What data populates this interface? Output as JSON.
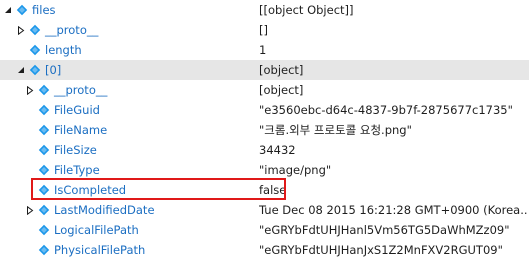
{
  "rows": [
    {
      "name": "files",
      "value": "[[object Object]]",
      "expander": "expanded",
      "icon": "property-icon"
    },
    {
      "name": "__proto__",
      "value": "[]",
      "expander": "collapsed",
      "icon": "property-icon"
    },
    {
      "name": "length",
      "value": "1",
      "expander": "none",
      "icon": "property-icon"
    },
    {
      "name": "[0]",
      "value": "[object]",
      "expander": "expanded",
      "icon": "property-icon"
    },
    {
      "name": "__proto__",
      "value": "[object]",
      "expander": "collapsed",
      "icon": "property-icon"
    },
    {
      "name": "FileGuid",
      "value": "\"e3560ebc-d64c-4837-9b7f-2875677c1735\"",
      "expander": "none",
      "icon": "property-icon"
    },
    {
      "name": "FileName",
      "value": "\"크롬.외부 프로토콜 요청.png\"",
      "expander": "none",
      "icon": "property-icon"
    },
    {
      "name": "FileSize",
      "value": "34432",
      "expander": "none",
      "icon": "property-icon"
    },
    {
      "name": "FileType",
      "value": "\"image/png\"",
      "expander": "none",
      "icon": "property-icon"
    },
    {
      "name": "IsCompleted",
      "value": "false",
      "expander": "none",
      "icon": "property-icon"
    },
    {
      "name": "LastModifiedDate",
      "value": "Tue Dec 08 2015 16:21:28 GMT+0900 (Korea...",
      "expander": "collapsed",
      "icon": "property-icon"
    },
    {
      "name": "LogicalFilePath",
      "value": "\"eGRYbFdtUHJHanl5Vm56TG5DaWhMZz09\"",
      "expander": "none",
      "icon": "property-icon"
    },
    {
      "name": "PhysicalFilePath",
      "value": "\"eGRYbFdtUHJHanJxS1Z2MnFXV2RGUT09\"",
      "expander": "none",
      "icon": "property-icon"
    }
  ],
  "colors": {
    "name_text": "#1b6ec2",
    "icon": "#1c97ea",
    "highlight": "#e01919",
    "selected_row": "#e6e6e6"
  }
}
